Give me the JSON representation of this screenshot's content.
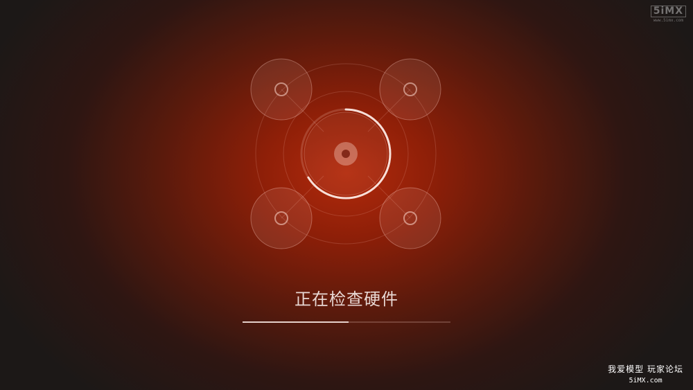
{
  "status": {
    "text": "正在检查硬件"
  },
  "progress": {
    "fraction": 0.51,
    "ring_fraction": 0.66
  },
  "watermark": {
    "brand": "5iMX",
    "url": "www.5imx.com"
  },
  "forum": {
    "title": "我爱模型 玩家论坛",
    "url": "5iMX.com"
  },
  "icons": {
    "center": "disc-icon",
    "motors": [
      "propeller-icon",
      "propeller-icon",
      "propeller-icon",
      "propeller-icon"
    ],
    "spinner": "loading-ring-icon"
  },
  "colors": {
    "accent": "#b22a0c",
    "text": "#e8d8d4",
    "progress_fill": "#fff0eb"
  }
}
